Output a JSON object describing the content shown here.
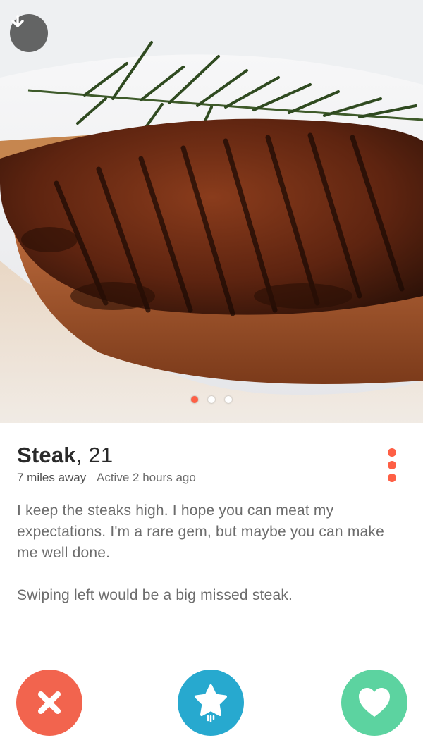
{
  "profile": {
    "name": "Steak",
    "age": "21",
    "distance": "7 miles away",
    "activity": "Active 2 hours ago",
    "bio": [
      "I keep the steaks high. I hope you can meat my expectations. I'm a rare gem, but maybe you can make me well done.",
      "Swiping left would be a big missed steak."
    ]
  },
  "photo": {
    "count": 3,
    "active_index": 0,
    "subject": "grilled steak on a white plate with rosemary"
  },
  "icons": {
    "collapse": "arrow-down-icon",
    "more": "more-vertical-icon",
    "nope": "close-icon",
    "super_like": "star-icon",
    "like": "heart-icon"
  },
  "colors": {
    "accent": "#fe5f45",
    "nope": "#f2644e",
    "super_like": "#27a9cf",
    "like": "#5cd3a0"
  }
}
